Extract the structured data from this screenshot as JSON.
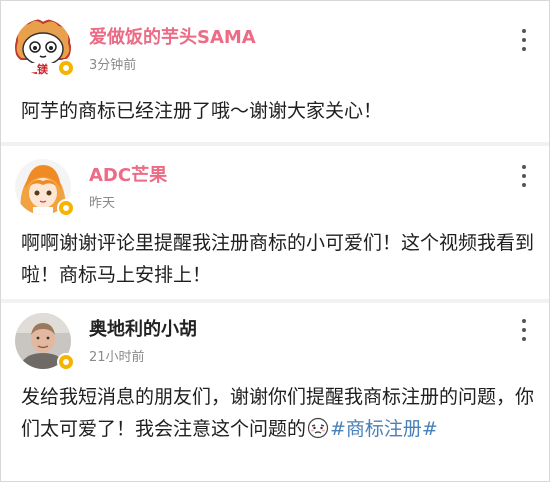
{
  "posts": [
    {
      "username": "爱做饭的芋头SAMA",
      "time": "3分钟前",
      "text": "阿芋的商标已经注册了哦～谢谢大家关心！",
      "avatar_text": "镁"
    },
    {
      "username": "ADC芒果",
      "time": "昨天",
      "text": "啊啊谢谢评论里提醒我注册商标的小可爱们！这个视频我看到啦！商标马上安排上！"
    },
    {
      "username": "奥地利的小胡",
      "time": "21小时前",
      "text_before": "发给我短消息的朋友们，谢谢你们提醒我商标注册的问题，你们太可爱了！我会注意这个问题的",
      "hashtag": "#商标注册#"
    }
  ],
  "colors": {
    "username_pink": "#ec6b85",
    "username_dark": "#222222",
    "hashtag": "#4a80b8",
    "verified_badge": "#f5b400",
    "time_gray": "#8a8a8a"
  },
  "icons": {
    "menu": "more-vertical-icon",
    "verified": "verified-badge-icon",
    "emoji": "embarrassed-emoji-icon"
  }
}
